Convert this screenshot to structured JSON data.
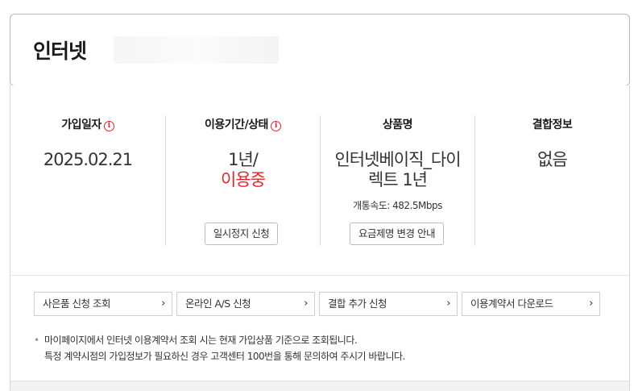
{
  "header": {
    "title": "인터넷"
  },
  "info": {
    "join_date": {
      "label": "가입일자",
      "value": "2025.02.21"
    },
    "period_status": {
      "label": "이용기간/상태",
      "period": "1년/",
      "status": "이용중",
      "button": "일시정지 신청"
    },
    "product": {
      "label": "상품명",
      "name_line1": "인터넷베이직_다이",
      "name_line2": "렉트 1년",
      "speed": "개통속도: 482.5Mbps",
      "button": "요금제명 변경 안내"
    },
    "bundle": {
      "label": "결합정보",
      "value": "없음"
    }
  },
  "links": [
    {
      "label": "사은품 신청 조회"
    },
    {
      "label": "온라인 A/S 신청"
    },
    {
      "label": "결합 추가 신청"
    },
    {
      "label": "이용계약서 다운로드"
    }
  ],
  "notice": {
    "line1": "마이페이지에서 인터넷 이용계약서 조회 시는 현재 가입상품 기준으로 조회됩니다.",
    "line2": "특정 계약시점의 가입정보가 필요하신 경우 고객센터 100번을 통해 문의하여 주시기 바랍니다."
  },
  "icons": {
    "info": "info-icon",
    "chevron": "chevron-right-icon"
  },
  "colors": {
    "accent": "#e0262c"
  }
}
